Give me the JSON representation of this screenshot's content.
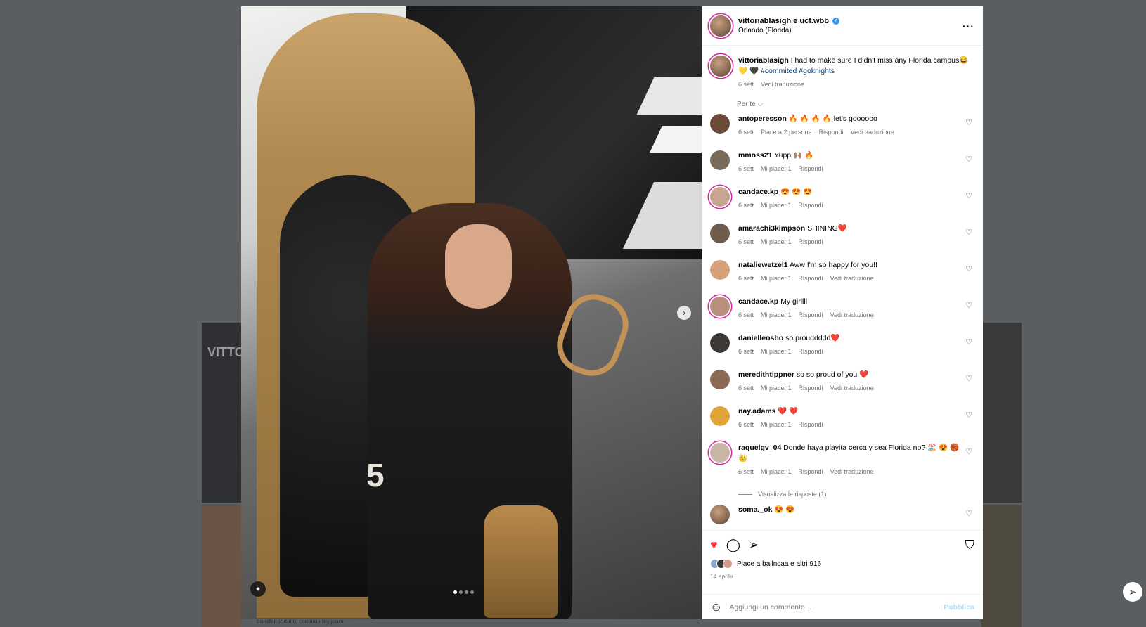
{
  "background": {
    "profile_label": "VITTO",
    "caption_fragment": "transfer portal to continue my journ"
  },
  "post": {
    "author": "vittoriablasigh e ucf.wbb",
    "location": "Orlando (Florida)",
    "caption_user": "vittoriablasigh",
    "caption_text": "I had to make sure I didn't miss any Florida campus😂 💛 🖤",
    "hashtags": [
      "#commited",
      "#goknights"
    ],
    "caption_date": "6 sett",
    "see_translation": "Vedi traduzione",
    "for_you_label": "Per te ⌵",
    "jersey_number": "5",
    "carousel_count": 4,
    "carousel_active": 0
  },
  "comments": [
    {
      "user": "antoperesson",
      "text": "🔥 🔥 🔥 🔥  let's goooooo",
      "date": "6 sett",
      "likes": "Piace a 2 persone",
      "reply": "Rispondi",
      "translate": "Vedi traduzione"
    },
    {
      "user": "mmoss21",
      "text": "Yupp 🙌🏽 🔥",
      "date": "6 sett",
      "likes": "Mi piace: 1",
      "reply": "Rispondi",
      "translate": ""
    },
    {
      "user": "candace.kp",
      "text": "😍 😍 😍",
      "date": "6 sett",
      "likes": "Mi piace: 1",
      "reply": "Rispondi",
      "translate": ""
    },
    {
      "user": "amarachi3kimpson",
      "text": "SHINING❤️",
      "date": "6 sett",
      "likes": "Mi piace: 1",
      "reply": "Rispondi",
      "translate": ""
    },
    {
      "user": "nataliewetzel1",
      "text": "Aww I'm so happy for you!!",
      "date": "6 sett",
      "likes": "Mi piace: 1",
      "reply": "Rispondi",
      "translate": "Vedi traduzione"
    },
    {
      "user": "candace.kp",
      "text": "My girllll",
      "date": "6 sett",
      "likes": "Mi piace: 1",
      "reply": "Rispondi",
      "translate": "Vedi traduzione"
    },
    {
      "user": "danielleosho",
      "text": "so prouddddd❤️",
      "date": "6 sett",
      "likes": "Mi piace: 1",
      "reply": "Rispondi",
      "translate": ""
    },
    {
      "user": "meredithtippner",
      "text": "so so proud of you ❤️",
      "date": "6 sett",
      "likes": "Mi piace: 1",
      "reply": "Rispondi",
      "translate": "Vedi traduzione"
    },
    {
      "user": "nay.adams",
      "text": "❤️ ❤️",
      "date": "6 sett",
      "likes": "Mi piace: 1",
      "reply": "Rispondi",
      "translate": ""
    },
    {
      "user": "raquelgv_04",
      "text": "Donde haya playita cerca y sea Florida no? 🏖️ 😍 🏀 👑",
      "date": "6 sett",
      "likes": "Mi piace: 1",
      "reply": "Rispondi",
      "translate": "Vedi traduzione"
    }
  ],
  "view_replies": "Visualizza le risposte (1)",
  "partial_comment": {
    "user": "soma._ok",
    "text": "😍 😍"
  },
  "actions": {
    "like_icon": "heart-filled-icon",
    "comment_icon": "comment-icon",
    "share_icon": "share-icon",
    "save_icon": "bookmark-icon",
    "likes_text": "Piace a ballncaa e altri 916",
    "post_date": "14 aprile"
  },
  "composer": {
    "placeholder": "Aggiungi un commento...",
    "publish": "Pubblica"
  },
  "colors": {
    "like_red": "#ff3040",
    "hashtag": "#00376b",
    "publish_disabled": "#b2dffc",
    "verified": "#3897f0"
  }
}
